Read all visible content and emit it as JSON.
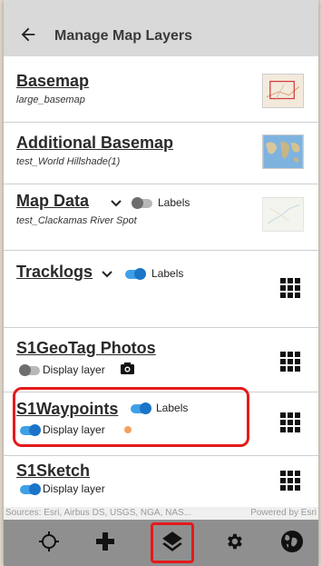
{
  "header": {
    "title": "Manage Map Layers",
    "back_icon": "arrow-left-icon"
  },
  "layers": [
    {
      "name": "Basemap",
      "subtitle": "large_basemap"
    },
    {
      "name": "Additional Basemap",
      "subtitle": "test_World Hillshade(1)"
    },
    {
      "name": "Map Data",
      "subtitle": "test_Clackamas River Spot",
      "toggle_label": "Labels",
      "toggle_on": false
    },
    {
      "name": "Tracklogs",
      "toggle_label": "Labels",
      "toggle_on": true
    },
    {
      "name": "S1GeoTag Photos",
      "toggle_label": "Display layer",
      "toggle_on": false
    },
    {
      "name": "S1Waypoints",
      "toggle_label": "Labels",
      "toggle_on": true,
      "toggle2_label": "Display layer",
      "toggle2_on": true,
      "color": "#f4a261"
    },
    {
      "name": "S1Sketch",
      "toggle_label": "Display layer",
      "toggle_on": true
    }
  ],
  "attribution": {
    "left": "Sources: Esri, Airbus DS, USGS, NGA, NAS...",
    "right": "Powered by Esri"
  },
  "bottom_nav": [
    "crosshair-icon",
    "plus-icon",
    "layers-icon",
    "gear-icon",
    "globe-icon"
  ],
  "colors": {
    "header_bg": "#d9d9d9",
    "toggle_on": "#1c74c8",
    "highlight": "#e41a1a",
    "waypoint_dot": "#f4a261"
  }
}
